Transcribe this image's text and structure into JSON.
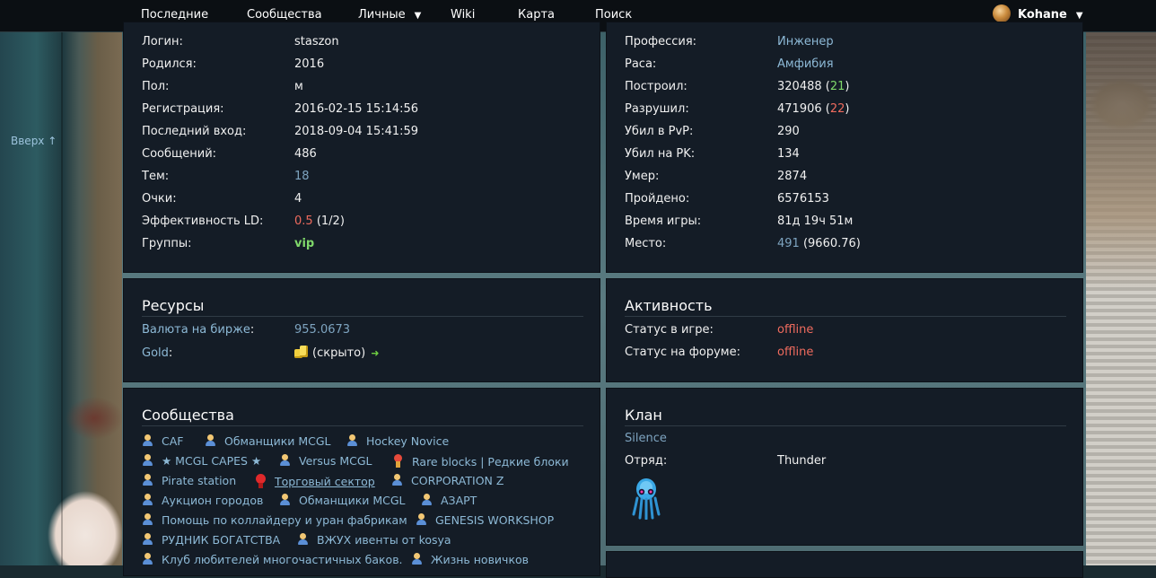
{
  "nav": {
    "items": [
      "Последние",
      "Сообщества",
      "Личные",
      "Wiki",
      "Карта",
      "Поиск"
    ],
    "dropdown_glyph": "▼",
    "user": "Kohane"
  },
  "scroll_up": "Вверх ↑",
  "profile": {
    "rows": [
      {
        "label": "Логин:",
        "value": "staszon"
      },
      {
        "label": "Родился:",
        "value": "2016"
      },
      {
        "label": "Пол:",
        "value": "м"
      },
      {
        "label": "Регистрация:",
        "value": "2016-02-15 15:14:56"
      },
      {
        "label": "Последний вход:",
        "value": "2018-09-04 15:41:59"
      },
      {
        "label": "Сообщений:",
        "value": "486"
      },
      {
        "label": "Тем:",
        "value": "18"
      },
      {
        "label": "Очки:",
        "value": "4"
      },
      {
        "label": "Эффективность LD:",
        "value_red": "0.5",
        "value_rest": " (1/2)"
      },
      {
        "label": "Группы:",
        "value": "vip"
      }
    ]
  },
  "stats": {
    "rows": [
      {
        "label": "Профессия:",
        "value": "Инженер"
      },
      {
        "label": "Раса:",
        "value": "Амфибия"
      },
      {
        "label": "Построил:",
        "value": "320488",
        "paren_open": " (",
        "extra": "21",
        "paren_close": ")"
      },
      {
        "label": "Разрушил:",
        "value": "471906",
        "paren_open": " (",
        "extra": "22",
        "paren_close": ")"
      },
      {
        "label": "Убил в PvP:",
        "value": "290"
      },
      {
        "label": "Убил на PK:",
        "value": "134"
      },
      {
        "label": "Умер:",
        "value": "2874"
      },
      {
        "label": "Пройдено:",
        "value": "6576153"
      },
      {
        "label": "Время игры:",
        "value": "81д 19ч 51м"
      },
      {
        "label": "Место:",
        "value": "491",
        "extra": " (9660.76)"
      }
    ]
  },
  "resources": {
    "title": "Ресурсы",
    "currency_label": "Валюта на бирже",
    "colon": ":",
    "currency_value": "955.0673",
    "gold_label": "Gold",
    "gold_value": "(скрыто)",
    "arrow": "➜"
  },
  "activity": {
    "title": "Активность",
    "game_label": "Статус в игре:",
    "game_value": "offline",
    "forum_label": "Статус на форуме:",
    "forum_value": "offline"
  },
  "communities": {
    "title": "Сообщества",
    "items": [
      "CAF",
      "Обманщики MCGL",
      "Hockey Novice",
      "★ MCGL CAPES ★",
      "Versus MCGL",
      "Rare blocks | Редкие блоки",
      "Pirate station",
      "Торговый сектор",
      "CORPORATION Z",
      "Аукцион городов",
      "Обманщики MCGL",
      "АЗАРТ",
      "Помощь по коллайдеру и уран фабрикам",
      "GENESIS WORKSHOP",
      "РУДНИК БОГАТСТВА",
      "ВЖУХ ивенты от kosya",
      "Клуб любителей многочастичных баков.",
      "Жизнь новичков"
    ]
  },
  "clan": {
    "title": "Клан",
    "name": "Silence",
    "squad_label": "Отряд:",
    "squad_value": "Thunder"
  }
}
